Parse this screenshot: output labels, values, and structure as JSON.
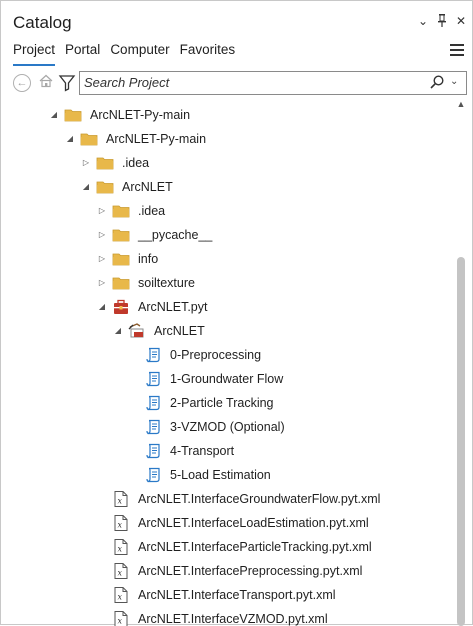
{
  "window": {
    "title": "Catalog"
  },
  "titlebar_icons": [
    "chevron-down-icon",
    "pin-icon",
    "close-icon"
  ],
  "tabs": [
    {
      "label": "Project",
      "active": true
    },
    {
      "label": "Portal",
      "active": false
    },
    {
      "label": "Computer",
      "active": false
    },
    {
      "label": "Favorites",
      "active": false
    }
  ],
  "search": {
    "placeholder": "Search Project",
    "value": ""
  },
  "tree": [
    {
      "label": "ArcNLET-Py-main",
      "depth": 0,
      "icon": "folder-icon",
      "expanded": true
    },
    {
      "label": "ArcNLET-Py-main",
      "depth": 1,
      "icon": "folder-icon",
      "expanded": true
    },
    {
      "label": ".idea",
      "depth": 2,
      "icon": "folder-icon",
      "expanded": false
    },
    {
      "label": "ArcNLET",
      "depth": 2,
      "icon": "folder-icon",
      "expanded": true
    },
    {
      "label": ".idea",
      "depth": 3,
      "icon": "folder-icon",
      "expanded": false
    },
    {
      "label": "__pycache__",
      "depth": 3,
      "icon": "folder-icon",
      "expanded": false
    },
    {
      "label": "info",
      "depth": 3,
      "icon": "folder-icon",
      "expanded": false
    },
    {
      "label": "soiltexture",
      "depth": 3,
      "icon": "folder-icon",
      "expanded": false
    },
    {
      "label": "ArcNLET.pyt",
      "depth": 3,
      "icon": "python-toolbox-icon",
      "expanded": true
    },
    {
      "label": "ArcNLET",
      "depth": 4,
      "icon": "toolset-icon",
      "expanded": true
    },
    {
      "label": "0-Preprocessing",
      "depth": 5,
      "icon": "script-tool-icon",
      "expanded": null
    },
    {
      "label": "1-Groundwater Flow",
      "depth": 5,
      "icon": "script-tool-icon",
      "expanded": null
    },
    {
      "label": "2-Particle Tracking",
      "depth": 5,
      "icon": "script-tool-icon",
      "expanded": null
    },
    {
      "label": "3-VZMOD (Optional)",
      "depth": 5,
      "icon": "script-tool-icon",
      "expanded": null
    },
    {
      "label": "4-Transport",
      "depth": 5,
      "icon": "script-tool-icon",
      "expanded": null
    },
    {
      "label": "5-Load Estimation",
      "depth": 5,
      "icon": "script-tool-icon",
      "expanded": null
    },
    {
      "label": "ArcNLET.InterfaceGroundwaterFlow.pyt.xml",
      "depth": 3,
      "icon": "xml-file-icon",
      "expanded": null
    },
    {
      "label": "ArcNLET.InterfaceLoadEstimation.pyt.xml",
      "depth": 3,
      "icon": "xml-file-icon",
      "expanded": null
    },
    {
      "label": "ArcNLET.InterfaceParticleTracking.pyt.xml",
      "depth": 3,
      "icon": "xml-file-icon",
      "expanded": null
    },
    {
      "label": "ArcNLET.InterfacePreprocessing.pyt.xml",
      "depth": 3,
      "icon": "xml-file-icon",
      "expanded": null
    },
    {
      "label": "ArcNLET.InterfaceTransport.pyt.xml",
      "depth": 3,
      "icon": "xml-file-icon",
      "expanded": null
    },
    {
      "label": "ArcNLET.InterfaceVZMOD.pyt.xml",
      "depth": 3,
      "icon": "xml-file-icon",
      "expanded": null
    }
  ],
  "colors": {
    "folder": "#e8b84a",
    "folder_dark": "#c99a2e",
    "tool": "#2a79c7",
    "accent": "#2a79c7",
    "toolbox": "#c0392b"
  }
}
